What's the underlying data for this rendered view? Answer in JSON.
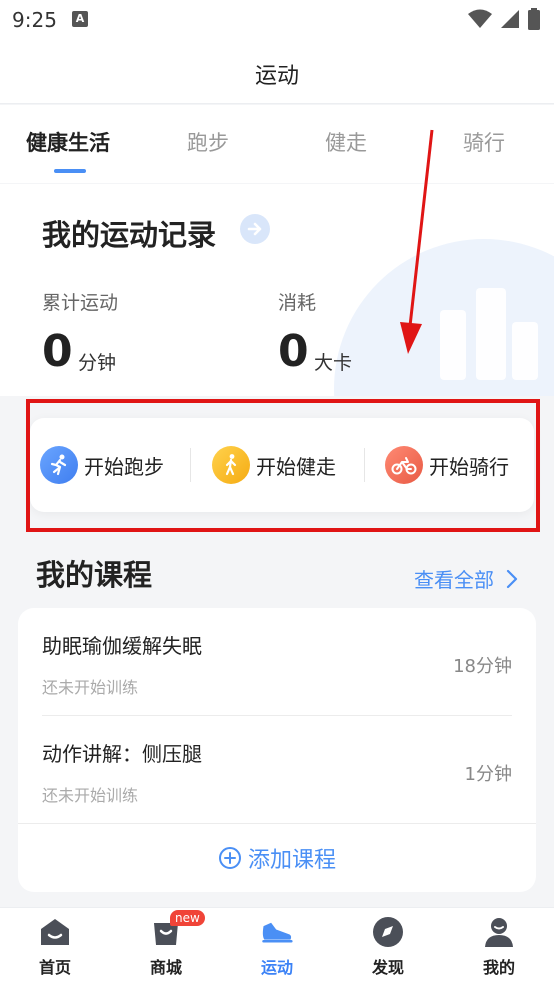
{
  "status": {
    "time": "9:25",
    "notif": "A"
  },
  "header": {
    "title": "运动"
  },
  "tabs": [
    {
      "label": "健康生活",
      "active": true
    },
    {
      "label": "跑步",
      "active": false
    },
    {
      "label": "健走",
      "active": false
    },
    {
      "label": "骑行",
      "active": false
    }
  ],
  "record": {
    "title": "我的运动记录",
    "stats": [
      {
        "label": "累计运动",
        "value": "0",
        "unit": "分钟"
      },
      {
        "label": "消耗",
        "value": "0",
        "unit": "大卡"
      }
    ]
  },
  "start_actions": [
    {
      "label": "开始跑步",
      "icon": "running-icon",
      "color": "#4a8ff5"
    },
    {
      "label": "开始健走",
      "icon": "walking-icon",
      "color": "#f5b81f"
    },
    {
      "label": "开始骑行",
      "icon": "cycling-icon",
      "color": "#f0705a"
    }
  ],
  "courses": {
    "title": "我的课程",
    "view_all": "查看全部",
    "items": [
      {
        "name": "助眠瑜伽缓解失眠",
        "status": "还未开始训练",
        "duration": "18分钟"
      },
      {
        "name": "动作讲解：侧压腿",
        "status": "还未开始训练",
        "duration": "1分钟"
      }
    ],
    "add_label": "添加课程"
  },
  "bottom_nav": [
    {
      "label": "首页",
      "icon": "home-icon",
      "active": false
    },
    {
      "label": "商城",
      "icon": "shop-icon",
      "active": false,
      "badge": "new"
    },
    {
      "label": "运动",
      "icon": "sport-shoe-icon",
      "active": true
    },
    {
      "label": "发现",
      "icon": "compass-icon",
      "active": false
    },
    {
      "label": "我的",
      "icon": "profile-icon",
      "active": false
    }
  ],
  "colors": {
    "accent": "#4a8ff5",
    "highlight": "#e01515",
    "badge": "#f04438"
  }
}
